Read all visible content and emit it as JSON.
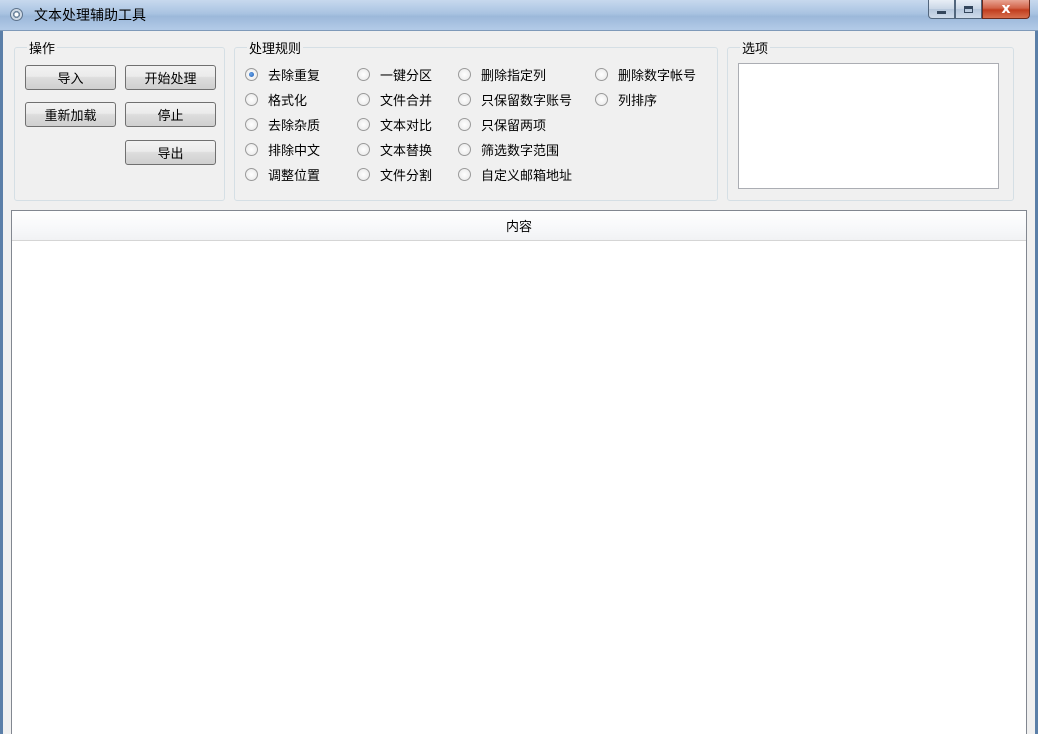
{
  "window": {
    "title": "文本处理辅助工具",
    "min_icon": "minimize-icon",
    "max_icon": "maximize-icon",
    "close_icon": "close-icon",
    "close_glyph": "x"
  },
  "actions": {
    "legend": "操作",
    "import": "导入",
    "start": "开始处理",
    "reload": "重新加载",
    "stop": "停止",
    "export": "导出"
  },
  "rules": {
    "legend": "处理规则",
    "options": [
      {
        "label": "去除重复",
        "checked": true
      },
      {
        "label": "一键分区",
        "checked": false
      },
      {
        "label": "删除指定列",
        "checked": false
      },
      {
        "label": "删除数字帐号",
        "checked": false
      },
      {
        "label": "格式化",
        "checked": false
      },
      {
        "label": "文件合并",
        "checked": false
      },
      {
        "label": "只保留数字账号",
        "checked": false
      },
      {
        "label": "列排序",
        "checked": false
      },
      {
        "label": "去除杂质",
        "checked": false
      },
      {
        "label": "文本对比",
        "checked": false
      },
      {
        "label": "只保留两项",
        "checked": false
      },
      {
        "label": "排除中文",
        "checked": false
      },
      {
        "label": "文本替换",
        "checked": false
      },
      {
        "label": "筛选数字范围",
        "checked": false
      },
      {
        "label": "调整位置",
        "checked": false
      },
      {
        "label": "文件分割",
        "checked": false
      },
      {
        "label": "自定义邮箱地址",
        "checked": false
      }
    ]
  },
  "options_panel": {
    "legend": "选项"
  },
  "content": {
    "header": "内容"
  },
  "colors": {
    "titlebar": "#a9c3e1",
    "close_button": "#c13d1f",
    "radio_selected": "#1c5bb4"
  }
}
